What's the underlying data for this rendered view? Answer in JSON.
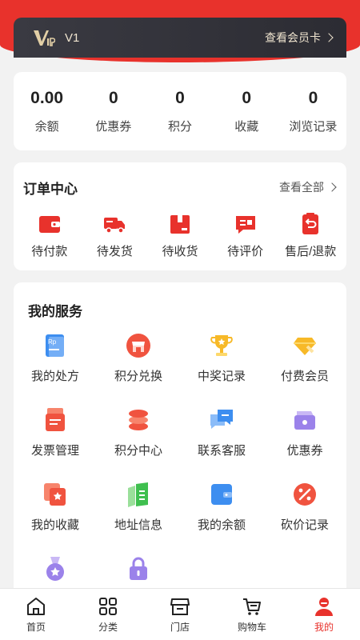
{
  "vip": {
    "level": "V1",
    "link_label": "查看会员卡"
  },
  "stats": [
    {
      "value": "0.00",
      "label": "余额"
    },
    {
      "value": "0",
      "label": "优惠券"
    },
    {
      "value": "0",
      "label": "积分"
    },
    {
      "value": "0",
      "label": "收藏"
    },
    {
      "value": "0",
      "label": "浏览记录"
    }
  ],
  "orders": {
    "title": "订单中心",
    "view_all": "查看全部",
    "items": [
      {
        "label": "待付款",
        "icon": "wallet-icon"
      },
      {
        "label": "待发货",
        "icon": "truck-icon"
      },
      {
        "label": "待收货",
        "icon": "package-icon"
      },
      {
        "label": "待评价",
        "icon": "review-icon"
      },
      {
        "label": "售后/退款",
        "icon": "refund-icon"
      }
    ]
  },
  "services": {
    "title": "我的服务",
    "items": [
      {
        "label": "我的处方",
        "icon": "prescription-icon"
      },
      {
        "label": "积分兑换",
        "icon": "store-icon"
      },
      {
        "label": "中奖记录",
        "icon": "trophy-icon"
      },
      {
        "label": "付费会员",
        "icon": "diamond-icon"
      },
      {
        "label": "发票管理",
        "icon": "invoice-icon"
      },
      {
        "label": "积分中心",
        "icon": "coins-icon"
      },
      {
        "label": "联系客服",
        "icon": "chat-icon"
      },
      {
        "label": "优惠券",
        "icon": "coupon-icon"
      },
      {
        "label": "我的收藏",
        "icon": "star-icon"
      },
      {
        "label": "地址信息",
        "icon": "map-icon"
      },
      {
        "label": "我的余额",
        "icon": "balance-icon"
      },
      {
        "label": "砍价记录",
        "icon": "discount-icon"
      },
      {
        "label": "",
        "icon": "medal-icon"
      },
      {
        "label": "",
        "icon": "lock-icon"
      }
    ]
  },
  "tabbar": [
    {
      "label": "首页",
      "icon": "home-icon"
    },
    {
      "label": "分类",
      "icon": "grid-icon"
    },
    {
      "label": "门店",
      "icon": "shop-icon"
    },
    {
      "label": "购物车",
      "icon": "cart-icon"
    },
    {
      "label": "我的",
      "icon": "user-icon",
      "active": true
    }
  ],
  "colors": {
    "accent": "#e8322c",
    "vip_bg": "#33333b",
    "vip_text": "#efe4cf"
  }
}
